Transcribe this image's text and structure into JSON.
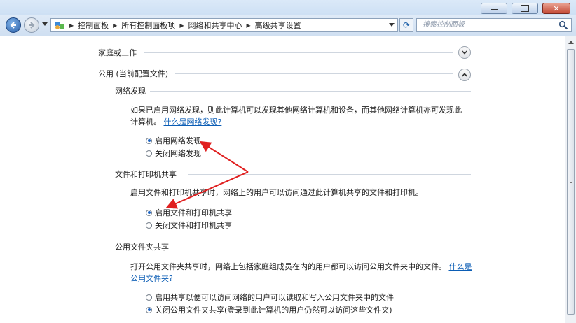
{
  "window": {
    "minimize_icon": "minimize-icon",
    "maximize_icon": "maximize-icon",
    "close_icon": "close-icon"
  },
  "navbar": {
    "breadcrumbs": [
      "控制面板",
      "所有控制面板项",
      "网络和共享中心",
      "高级共享设置"
    ],
    "search_placeholder": "搜索控制面板"
  },
  "sections": {
    "home_work": {
      "label": "家庭或工作",
      "state": "collapsed"
    },
    "public": {
      "label": "公用 (当前配置文件)",
      "state": "expanded"
    }
  },
  "network_discovery": {
    "title": "网络发现",
    "desc": "如果已启用网络发现，则此计算机可以发现其他网络计算机和设备，而其他网络计算机亦可发现此",
    "desc2": "计算机。",
    "link": "什么是网络发现?",
    "options": [
      {
        "label": "启用网络发现",
        "selected": true
      },
      {
        "label": "关闭网络发现",
        "selected": false
      }
    ]
  },
  "file_printer_sharing": {
    "title": "文件和打印机共享",
    "desc": "启用文件和打印机共享时，网络上的用户可以访问通过此计算机共享的文件和打印机。",
    "options": [
      {
        "label": "启用文件和打印机共享",
        "selected": true
      },
      {
        "label": "关闭文件和打印机共享",
        "selected": false
      }
    ]
  },
  "public_folder_sharing": {
    "title": "公用文件夹共享",
    "desc": "打开公用文件夹共享时，网络上包括家庭组成员在内的用户都可以访问公用文件夹中的文件。",
    "link": "什么是公用文件夹?",
    "options": [
      {
        "label": "启用共享以便可以访问网络的用户可以读取和写入公用文件夹中的文件",
        "selected": false
      },
      {
        "label": "关闭公用文件夹共享(登录到此计算机的用户仍然可以访问这些文件夹)",
        "selected": true
      }
    ]
  }
}
